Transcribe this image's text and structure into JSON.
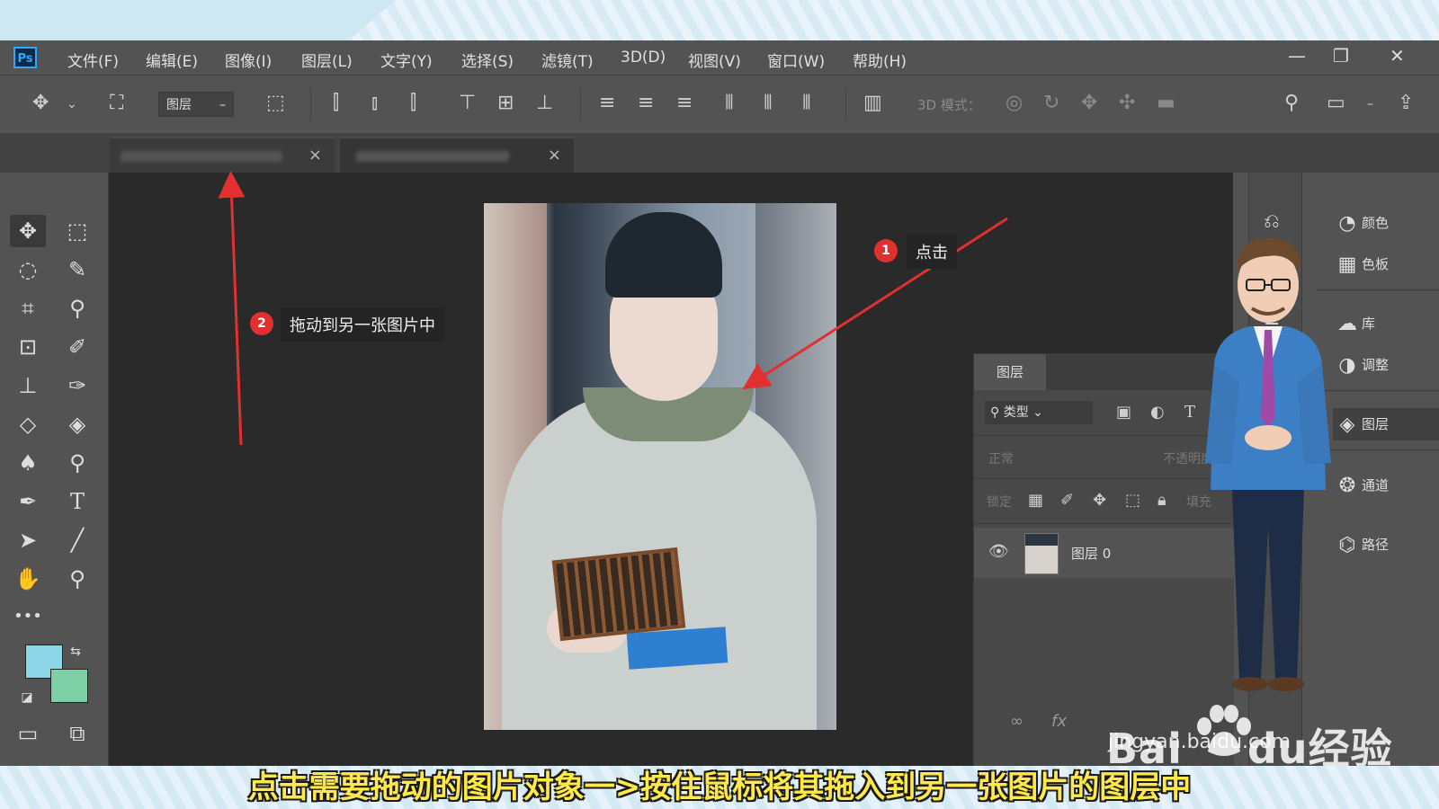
{
  "app": {
    "logo_text": "Ps"
  },
  "menu": [
    "文件(F)",
    "编辑(E)",
    "图像(I)",
    "图层(L)",
    "文字(Y)",
    "选择(S)",
    "滤镜(T)",
    "3D(D)",
    "视图(V)",
    "窗口(W)",
    "帮助(H)"
  ],
  "window_controls": {
    "minimize": "—",
    "restore": "❐",
    "close": "✕"
  },
  "options_bar": {
    "layer_select": "图层",
    "mode_3d": "3D 模式："
  },
  "tabs": [
    {
      "close": "×"
    },
    {
      "close": "×"
    }
  ],
  "annotations": {
    "step1_badge": "1",
    "step1_label": "点击",
    "step2_badge": "2",
    "step2_label": "拖动到另一张图片中"
  },
  "layers_panel": {
    "title": "图层",
    "filter_label": "类型",
    "blend_mode": "正常",
    "opacity_label": "不透明度",
    "lock_label": "锁定",
    "fill_label": "填充",
    "layer_name": "图层 0"
  },
  "right_panels": [
    {
      "icon": "color-icon",
      "label": "颜色"
    },
    {
      "icon": "swatches-icon",
      "label": "色板"
    },
    {
      "icon": "libraries-icon",
      "label": "库"
    },
    {
      "icon": "adjustments-icon",
      "label": "调整"
    },
    {
      "icon": "layers-icon",
      "label": "图层",
      "active": true
    },
    {
      "icon": "channels-icon",
      "label": "通道"
    },
    {
      "icon": "paths-icon",
      "label": "路径"
    }
  ],
  "colors": {
    "foreground": "#8dd6e8",
    "background": "#7fcfa6",
    "accent": "#e23030",
    "subtitle": "#ffe94a"
  },
  "watermark": {
    "brand": "Bai",
    "brand2": "du",
    "brand3": "经验",
    "url": "jingyan.baidu.com"
  },
  "subtitle": "点击需要拖动的图片对象一>按住鼠标将其拖入到另一张图片的图层中"
}
